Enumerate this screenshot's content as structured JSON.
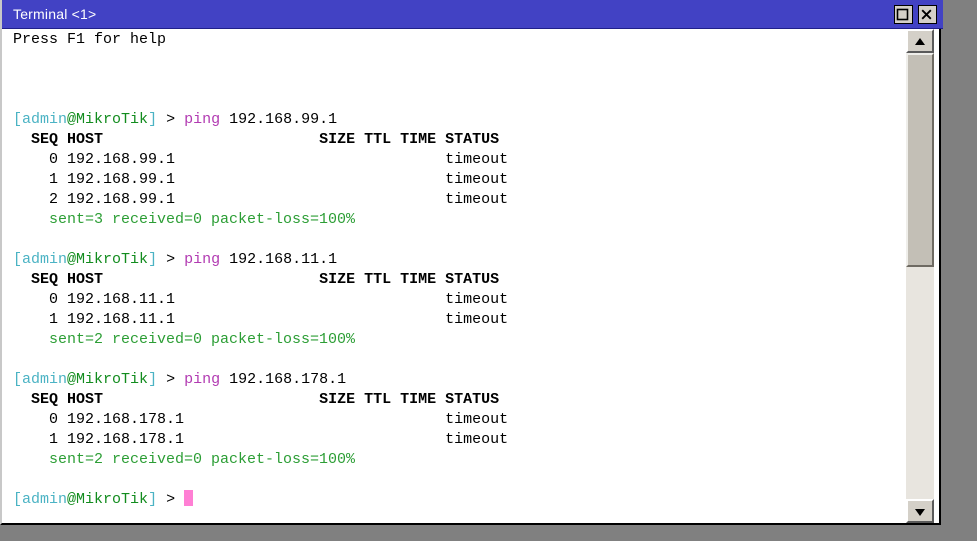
{
  "window": {
    "title": "Terminal <1>",
    "buttons": {
      "maximize": "maximize-button",
      "close": "close-button"
    }
  },
  "colors": {
    "titlebar": "#4242c4",
    "prompt_user": "#4bb3c4",
    "prompt_host": "#128c1e",
    "command": "#b23ab2",
    "summary": "#2c9e35",
    "cursor": "#ff7fd4",
    "background": "#ffffff",
    "desktop": "#808080"
  },
  "terminal": {
    "help_line": "Press F1 for help",
    "prompt": {
      "open_bracket": "[",
      "user": "admin",
      "at": "@",
      "host": "MikroTik",
      "close_bracket": "]",
      "arrow": "> "
    },
    "command_name": "ping",
    "table_headers": {
      "seq_host": "  SEQ HOST",
      "size_ttl_time": "SIZE TTL TIME",
      "status": "STATUS"
    },
    "sessions": [
      {
        "target": "192.168.99.1",
        "command_args": " 192.168.99.1",
        "rows": [
          {
            "seq": "0",
            "host": "192.168.99.1",
            "status": "timeout"
          },
          {
            "seq": "1",
            "host": "192.168.99.1",
            "status": "timeout"
          },
          {
            "seq": "2",
            "host": "192.168.99.1",
            "status": "timeout"
          }
        ],
        "summary": "    sent=3 received=0 packet-loss=100%"
      },
      {
        "target": "192.168.11.1",
        "command_args": " 192.168.11.1",
        "rows": [
          {
            "seq": "0",
            "host": "192.168.11.1",
            "status": "timeout"
          },
          {
            "seq": "1",
            "host": "192.168.11.1",
            "status": "timeout"
          }
        ],
        "summary": "    sent=2 received=0 packet-loss=100%"
      },
      {
        "target": "192.168.178.1",
        "command_args": " 192.168.178.1",
        "rows": [
          {
            "seq": "0",
            "host": "192.168.178.1",
            "status": "timeout"
          },
          {
            "seq": "1",
            "host": "192.168.178.1",
            "status": "timeout"
          }
        ],
        "summary": "    sent=2 received=0 packet-loss=100%"
      }
    ]
  },
  "scrollbar": {
    "up_arrow": "scroll-up-arrow",
    "down_arrow": "scroll-down-arrow",
    "thumb_top_pct": 0,
    "thumb_height_pct": 48
  }
}
